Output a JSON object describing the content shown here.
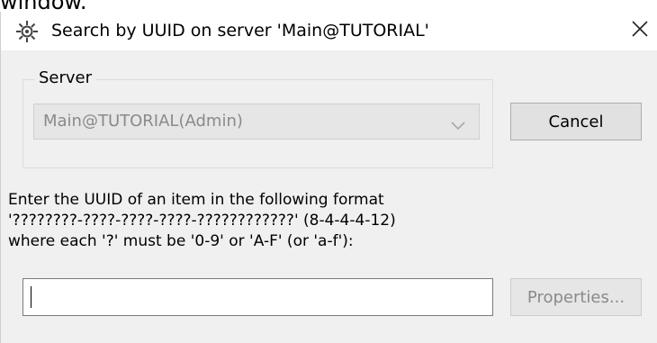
{
  "background_text": "window.",
  "titlebar": {
    "title": "Search by UUID on server 'Main@TUTORIAL'",
    "app_icon": "gear-icon",
    "close_icon": "close-icon"
  },
  "server_group": {
    "legend": "Server",
    "selected": "Main@TUTORIAL(Admin)",
    "chevron_icon": "chevron-down-icon"
  },
  "buttons": {
    "cancel_label": "Cancel",
    "properties_label": "Properties..."
  },
  "instructions": {
    "line1": "Enter the UUID of an item in the following format",
    "line2": "'????????-????-????-????-????????????' (8-4-4-4-12)",
    "line3": "where each '?' must be '0-9' or 'A-F' (or 'a-f'):"
  },
  "uuid_input": {
    "value": "",
    "placeholder": ""
  },
  "colors": {
    "dialog_bg": "#f0f0f0",
    "titlebar_bg": "#ffffff",
    "disabled_text": "#8a8a8a",
    "button_bg": "#e1e1e1"
  }
}
